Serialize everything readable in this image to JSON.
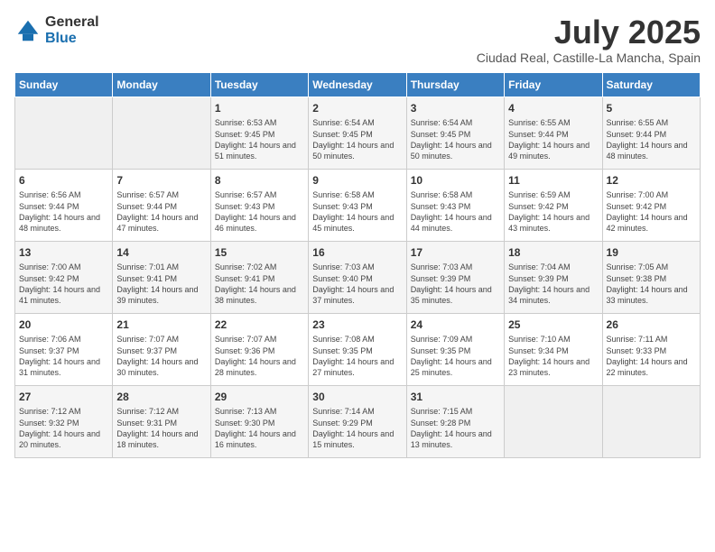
{
  "header": {
    "logo_line1": "General",
    "logo_line2": "Blue",
    "month": "July 2025",
    "location": "Ciudad Real, Castille-La Mancha, Spain"
  },
  "weekdays": [
    "Sunday",
    "Monday",
    "Tuesday",
    "Wednesday",
    "Thursday",
    "Friday",
    "Saturday"
  ],
  "weeks": [
    [
      {
        "day": "",
        "sunrise": "",
        "sunset": "",
        "daylight": ""
      },
      {
        "day": "",
        "sunrise": "",
        "sunset": "",
        "daylight": ""
      },
      {
        "day": "1",
        "sunrise": "Sunrise: 6:53 AM",
        "sunset": "Sunset: 9:45 PM",
        "daylight": "Daylight: 14 hours and 51 minutes."
      },
      {
        "day": "2",
        "sunrise": "Sunrise: 6:54 AM",
        "sunset": "Sunset: 9:45 PM",
        "daylight": "Daylight: 14 hours and 50 minutes."
      },
      {
        "day": "3",
        "sunrise": "Sunrise: 6:54 AM",
        "sunset": "Sunset: 9:45 PM",
        "daylight": "Daylight: 14 hours and 50 minutes."
      },
      {
        "day": "4",
        "sunrise": "Sunrise: 6:55 AM",
        "sunset": "Sunset: 9:44 PM",
        "daylight": "Daylight: 14 hours and 49 minutes."
      },
      {
        "day": "5",
        "sunrise": "Sunrise: 6:55 AM",
        "sunset": "Sunset: 9:44 PM",
        "daylight": "Daylight: 14 hours and 48 minutes."
      }
    ],
    [
      {
        "day": "6",
        "sunrise": "Sunrise: 6:56 AM",
        "sunset": "Sunset: 9:44 PM",
        "daylight": "Daylight: 14 hours and 48 minutes."
      },
      {
        "day": "7",
        "sunrise": "Sunrise: 6:57 AM",
        "sunset": "Sunset: 9:44 PM",
        "daylight": "Daylight: 14 hours and 47 minutes."
      },
      {
        "day": "8",
        "sunrise": "Sunrise: 6:57 AM",
        "sunset": "Sunset: 9:43 PM",
        "daylight": "Daylight: 14 hours and 46 minutes."
      },
      {
        "day": "9",
        "sunrise": "Sunrise: 6:58 AM",
        "sunset": "Sunset: 9:43 PM",
        "daylight": "Daylight: 14 hours and 45 minutes."
      },
      {
        "day": "10",
        "sunrise": "Sunrise: 6:58 AM",
        "sunset": "Sunset: 9:43 PM",
        "daylight": "Daylight: 14 hours and 44 minutes."
      },
      {
        "day": "11",
        "sunrise": "Sunrise: 6:59 AM",
        "sunset": "Sunset: 9:42 PM",
        "daylight": "Daylight: 14 hours and 43 minutes."
      },
      {
        "day": "12",
        "sunrise": "Sunrise: 7:00 AM",
        "sunset": "Sunset: 9:42 PM",
        "daylight": "Daylight: 14 hours and 42 minutes."
      }
    ],
    [
      {
        "day": "13",
        "sunrise": "Sunrise: 7:00 AM",
        "sunset": "Sunset: 9:42 PM",
        "daylight": "Daylight: 14 hours and 41 minutes."
      },
      {
        "day": "14",
        "sunrise": "Sunrise: 7:01 AM",
        "sunset": "Sunset: 9:41 PM",
        "daylight": "Daylight: 14 hours and 39 minutes."
      },
      {
        "day": "15",
        "sunrise": "Sunrise: 7:02 AM",
        "sunset": "Sunset: 9:41 PM",
        "daylight": "Daylight: 14 hours and 38 minutes."
      },
      {
        "day": "16",
        "sunrise": "Sunrise: 7:03 AM",
        "sunset": "Sunset: 9:40 PM",
        "daylight": "Daylight: 14 hours and 37 minutes."
      },
      {
        "day": "17",
        "sunrise": "Sunrise: 7:03 AM",
        "sunset": "Sunset: 9:39 PM",
        "daylight": "Daylight: 14 hours and 35 minutes."
      },
      {
        "day": "18",
        "sunrise": "Sunrise: 7:04 AM",
        "sunset": "Sunset: 9:39 PM",
        "daylight": "Daylight: 14 hours and 34 minutes."
      },
      {
        "day": "19",
        "sunrise": "Sunrise: 7:05 AM",
        "sunset": "Sunset: 9:38 PM",
        "daylight": "Daylight: 14 hours and 33 minutes."
      }
    ],
    [
      {
        "day": "20",
        "sunrise": "Sunrise: 7:06 AM",
        "sunset": "Sunset: 9:37 PM",
        "daylight": "Daylight: 14 hours and 31 minutes."
      },
      {
        "day": "21",
        "sunrise": "Sunrise: 7:07 AM",
        "sunset": "Sunset: 9:37 PM",
        "daylight": "Daylight: 14 hours and 30 minutes."
      },
      {
        "day": "22",
        "sunrise": "Sunrise: 7:07 AM",
        "sunset": "Sunset: 9:36 PM",
        "daylight": "Daylight: 14 hours and 28 minutes."
      },
      {
        "day": "23",
        "sunrise": "Sunrise: 7:08 AM",
        "sunset": "Sunset: 9:35 PM",
        "daylight": "Daylight: 14 hours and 27 minutes."
      },
      {
        "day": "24",
        "sunrise": "Sunrise: 7:09 AM",
        "sunset": "Sunset: 9:35 PM",
        "daylight": "Daylight: 14 hours and 25 minutes."
      },
      {
        "day": "25",
        "sunrise": "Sunrise: 7:10 AM",
        "sunset": "Sunset: 9:34 PM",
        "daylight": "Daylight: 14 hours and 23 minutes."
      },
      {
        "day": "26",
        "sunrise": "Sunrise: 7:11 AM",
        "sunset": "Sunset: 9:33 PM",
        "daylight": "Daylight: 14 hours and 22 minutes."
      }
    ],
    [
      {
        "day": "27",
        "sunrise": "Sunrise: 7:12 AM",
        "sunset": "Sunset: 9:32 PM",
        "daylight": "Daylight: 14 hours and 20 minutes."
      },
      {
        "day": "28",
        "sunrise": "Sunrise: 7:12 AM",
        "sunset": "Sunset: 9:31 PM",
        "daylight": "Daylight: 14 hours and 18 minutes."
      },
      {
        "day": "29",
        "sunrise": "Sunrise: 7:13 AM",
        "sunset": "Sunset: 9:30 PM",
        "daylight": "Daylight: 14 hours and 16 minutes."
      },
      {
        "day": "30",
        "sunrise": "Sunrise: 7:14 AM",
        "sunset": "Sunset: 9:29 PM",
        "daylight": "Daylight: 14 hours and 15 minutes."
      },
      {
        "day": "31",
        "sunrise": "Sunrise: 7:15 AM",
        "sunset": "Sunset: 9:28 PM",
        "daylight": "Daylight: 14 hours and 13 minutes."
      },
      {
        "day": "",
        "sunrise": "",
        "sunset": "",
        "daylight": ""
      },
      {
        "day": "",
        "sunrise": "",
        "sunset": "",
        "daylight": ""
      }
    ]
  ]
}
